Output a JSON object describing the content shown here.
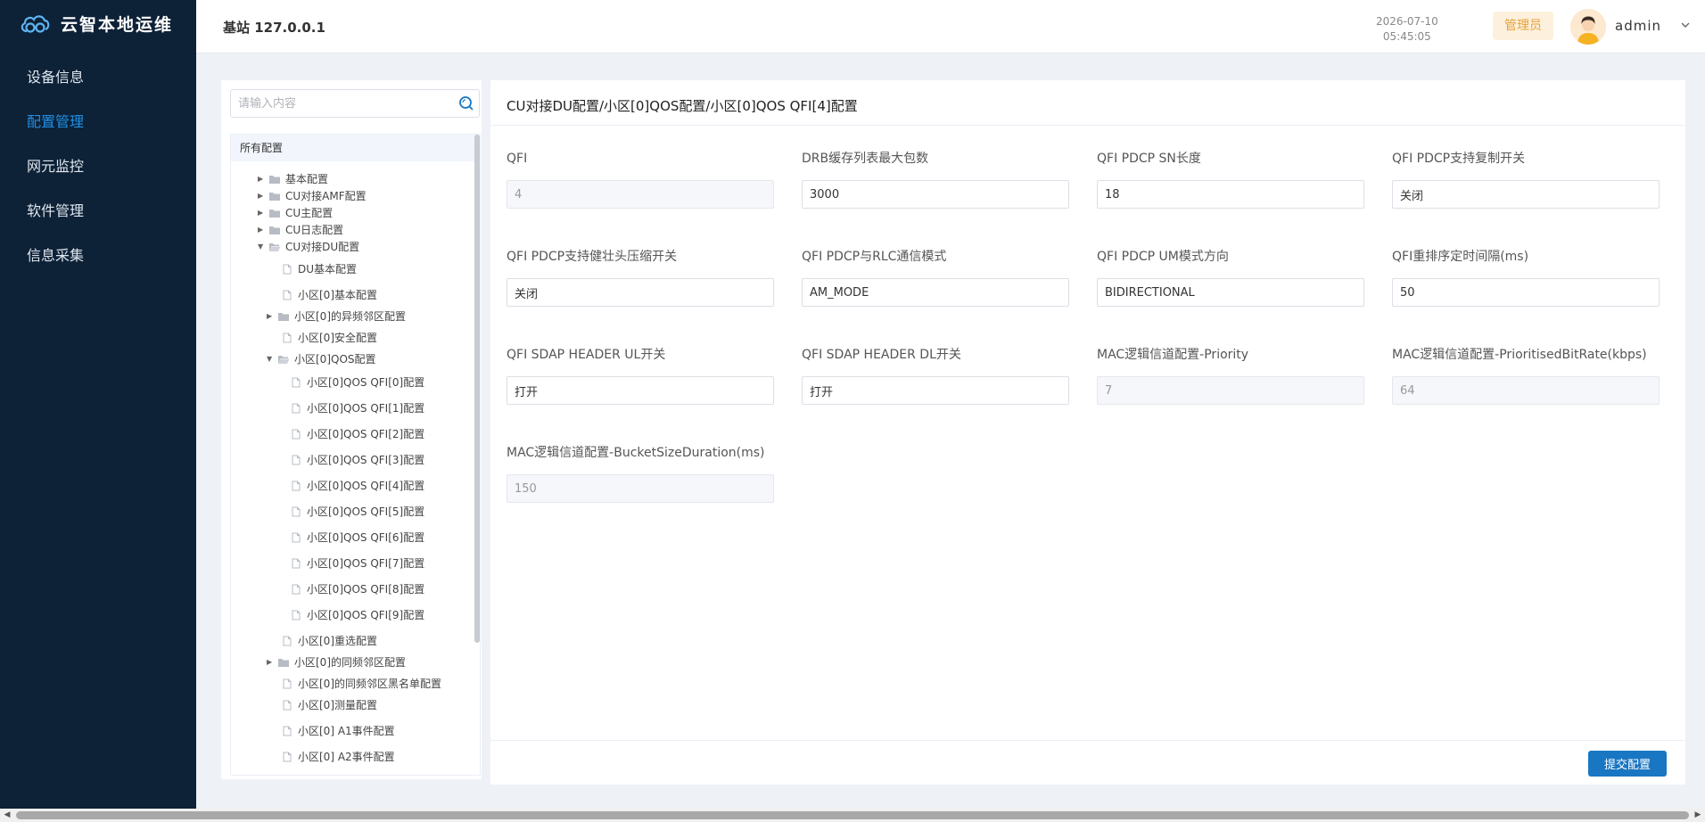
{
  "app": {
    "name": "云智本地运维",
    "station": "基站 127.0.0.1"
  },
  "nav": [
    {
      "label": "设备信息",
      "active": false
    },
    {
      "label": "配置管理",
      "active": true
    },
    {
      "label": "网元监控",
      "active": false
    },
    {
      "label": "软件管理",
      "active": false
    },
    {
      "label": "信息采集",
      "active": false
    }
  ],
  "header": {
    "date": "2026-07-10",
    "time": "05:45:05",
    "role": "管理员",
    "user": "admin"
  },
  "tree": {
    "search_placeholder": "请输入内容",
    "root": "所有配置",
    "nodes": [
      {
        "label": "基本配置",
        "type": "folder",
        "expanded": false
      },
      {
        "label": "CU对接AMF配置",
        "type": "folder",
        "expanded": false
      },
      {
        "label": "CU主配置",
        "type": "folder",
        "expanded": false
      },
      {
        "label": "CU日志配置",
        "type": "folder",
        "expanded": false
      },
      {
        "label": "CU对接DU配置",
        "type": "folder",
        "expanded": true
      },
      {
        "label": "DU基本配置",
        "type": "file"
      },
      {
        "label": "小区[0]基本配置",
        "type": "file"
      },
      {
        "label": "小区[0]的异频邻区配置",
        "type": "folder",
        "expanded": false
      },
      {
        "label": "小区[0]安全配置",
        "type": "file"
      },
      {
        "label": "小区[0]QOS配置",
        "type": "folder",
        "expanded": true
      },
      {
        "label": "小区[0]QOS QFI[0]配置",
        "type": "file"
      },
      {
        "label": "小区[0]QOS QFI[1]配置",
        "type": "file"
      },
      {
        "label": "小区[0]QOS QFI[2]配置",
        "type": "file"
      },
      {
        "label": "小区[0]QOS QFI[3]配置",
        "type": "file"
      },
      {
        "label": "小区[0]QOS QFI[4]配置",
        "type": "file"
      },
      {
        "label": "小区[0]QOS QFI[5]配置",
        "type": "file"
      },
      {
        "label": "小区[0]QOS QFI[6]配置",
        "type": "file"
      },
      {
        "label": "小区[0]QOS QFI[7]配置",
        "type": "file"
      },
      {
        "label": "小区[0]QOS QFI[8]配置",
        "type": "file"
      },
      {
        "label": "小区[0]QOS QFI[9]配置",
        "type": "file"
      },
      {
        "label": "小区[0]重选配置",
        "type": "file"
      },
      {
        "label": "小区[0]的同频邻区配置",
        "type": "folder",
        "expanded": false
      },
      {
        "label": "小区[0]的同频邻区黑名单配置",
        "type": "file"
      },
      {
        "label": "小区[0]测量配置",
        "type": "file"
      },
      {
        "label": "小区[0] A1事件配置",
        "type": "file"
      },
      {
        "label": "小区[0] A2事件配置",
        "type": "file"
      }
    ]
  },
  "main": {
    "title": "CU对接DU配置/小区[0]QOS配置/小区[0]QOS QFI[4]配置",
    "fields": [
      {
        "label": "QFI",
        "value": "4",
        "disabled": true
      },
      {
        "label": "DRB缓存列表最大包数",
        "value": "3000",
        "disabled": false
      },
      {
        "label": "QFI PDCP SN长度",
        "value": "18",
        "disabled": false
      },
      {
        "label": "QFI PDCP支持复制开关",
        "value": "关闭",
        "disabled": false
      },
      {
        "label": "QFI PDCP支持健壮头压缩开关",
        "value": "关闭",
        "disabled": false
      },
      {
        "label": "QFI PDCP与RLC通信模式",
        "value": "AM_MODE",
        "disabled": false
      },
      {
        "label": "QFI PDCP UM模式方向",
        "value": "BIDIRECTIONAL",
        "disabled": false
      },
      {
        "label": "QFI重排序定时间隔(ms)",
        "value": "50",
        "disabled": false
      },
      {
        "label": "QFI SDAP HEADER UL开关",
        "value": "打开",
        "disabled": false
      },
      {
        "label": "QFI SDAP HEADER DL开关",
        "value": "打开",
        "disabled": false
      },
      {
        "label": "MAC逻辑信道配置-Priority",
        "value": "7",
        "disabled": true
      },
      {
        "label": "MAC逻辑信道配置-PrioritisedBitRate(kbps)",
        "value": "64",
        "disabled": true
      },
      {
        "label": "MAC逻辑信道配置-BucketSizeDuration(ms)",
        "value": "150",
        "disabled": true
      }
    ],
    "submit_label": "提交配置"
  },
  "colors": {
    "sidebar_bg": "#0d2137",
    "accent": "#1e90e6",
    "submit_bg": "#1976c2",
    "role_badge_bg": "#fdf0dc",
    "role_badge_fg": "#e6a23c"
  }
}
